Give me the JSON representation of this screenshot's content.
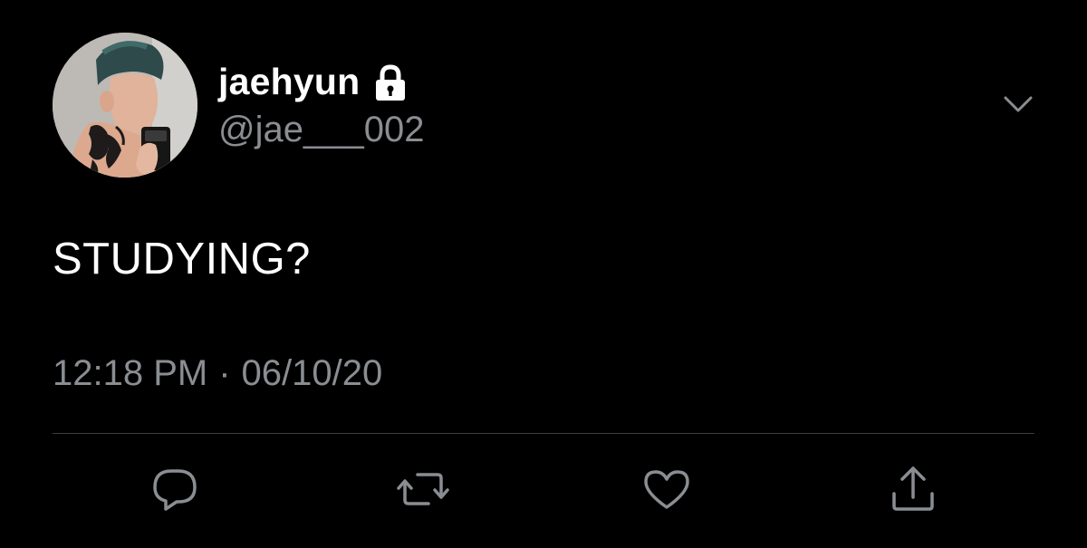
{
  "tweet": {
    "author": {
      "display_name": "jaehyun",
      "handle": "@jae___002",
      "protected_icon": "lock-icon",
      "avatar": "profile-photo"
    },
    "text": "STUDYING?",
    "time": "12:18 PM",
    "separator": "·",
    "date": "06/10/20",
    "menu_icon": "chevron-down-icon",
    "actions": [
      {
        "name": "reply",
        "icon": "speech-bubble-icon"
      },
      {
        "name": "retweet",
        "icon": "retweet-arrows-icon"
      },
      {
        "name": "like",
        "icon": "heart-icon"
      },
      {
        "name": "share",
        "icon": "share-upload-icon"
      }
    ]
  },
  "colors": {
    "background": "#000000",
    "primary_text": "#ffffff",
    "secondary_text": "#8a8d91",
    "icon": "#8a8d91",
    "divider": "#3a3d41"
  }
}
